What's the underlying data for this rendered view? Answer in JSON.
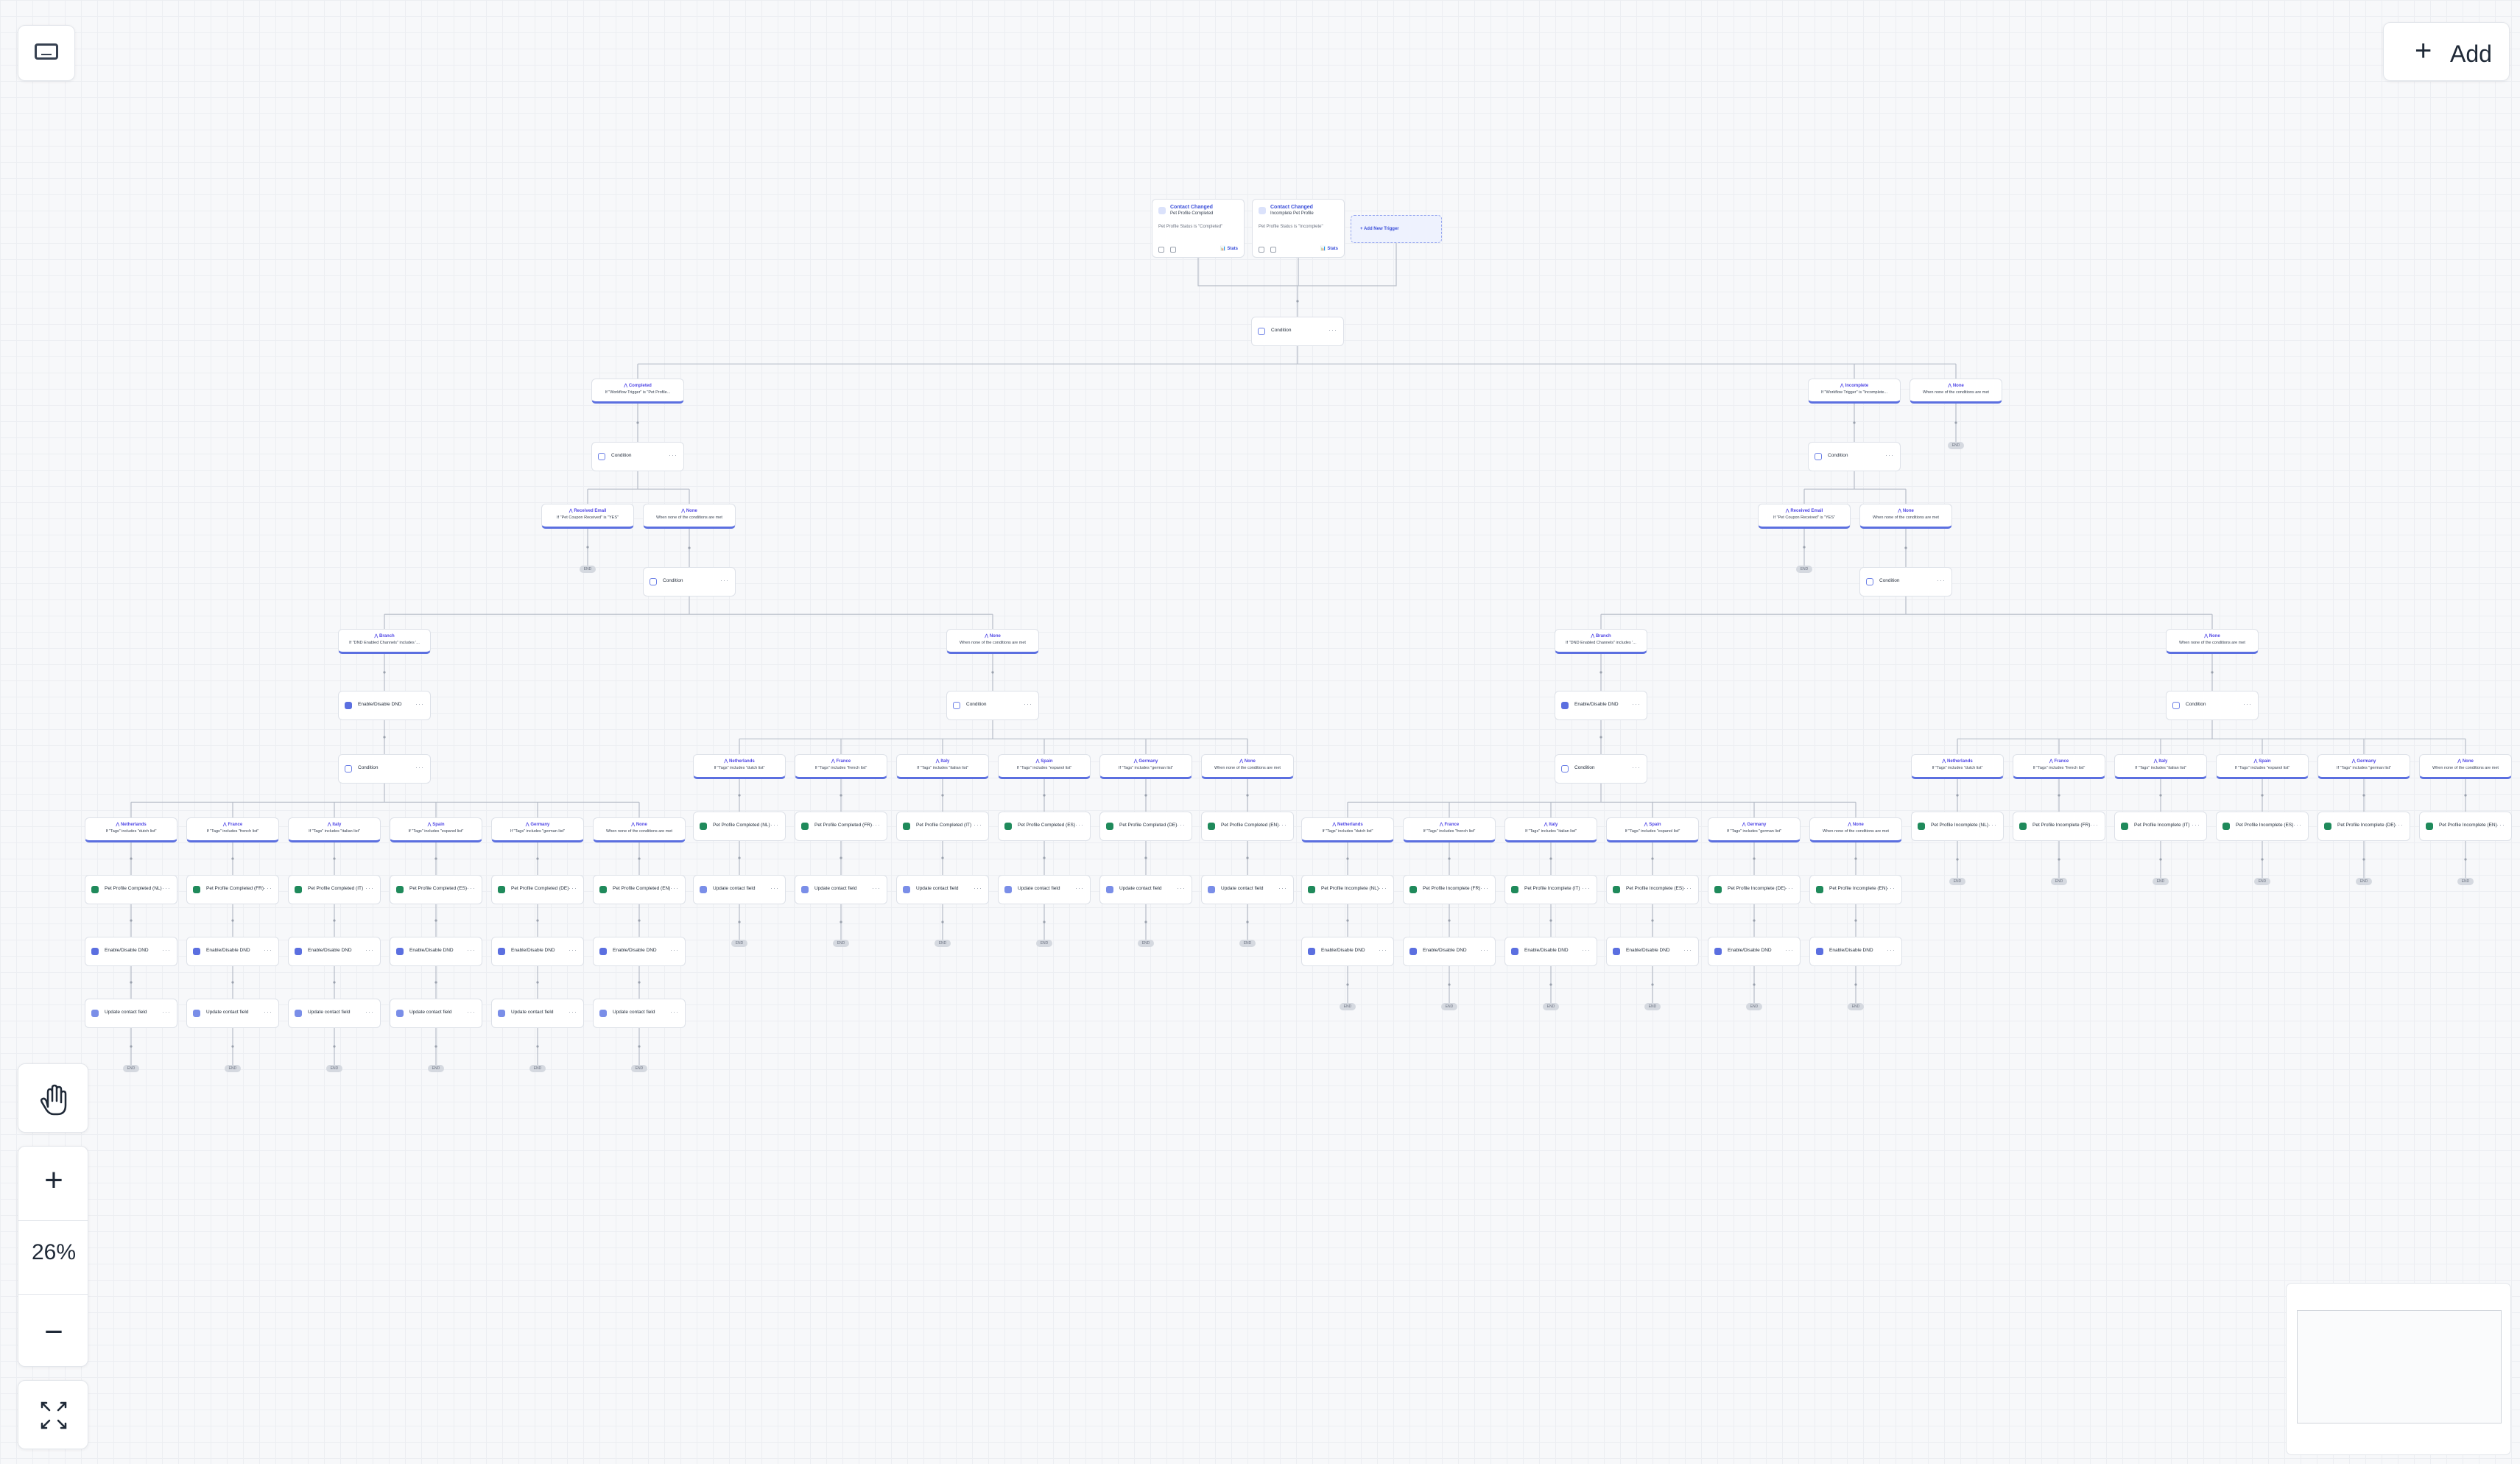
{
  "canvas": {
    "zoom_level": "26%"
  },
  "toolbar": {
    "add_label": "Add",
    "keyboard_icon": "keyboard-icon",
    "hand_icon": "hand-icon",
    "zoom_in_icon": "plus-icon",
    "zoom_out_icon": "minus-icon",
    "fit_icon": "fit-view-icon"
  },
  "colors": {
    "accent": "#4f46e5",
    "branch_underline": "#5b6fe0",
    "canvas_bg": "#f7f8fa",
    "node_border": "#dde1e8",
    "end_pill": "#d5d9e0"
  },
  "triggers": [
    {
      "title": "Contact Changed",
      "subtitle": "Pet Profile Completed",
      "desc": "Pet Profile Status is \"Completed\"",
      "stats": "Stats"
    },
    {
      "title": "Contact Changed",
      "subtitle": "Incomplete Pet Profile",
      "desc": "Pet Profile Status is \"Incomplete\"",
      "stats": "Stats"
    }
  ],
  "add_trigger": "Add New Trigger",
  "labels": {
    "condition": "Condition",
    "end": "END",
    "none": "None",
    "none_desc": "When none of the conditions are met",
    "enable_dnd": "Enable/Disable DND",
    "update_field": "Update contact field",
    "completed": "Completed",
    "completed_desc": "If \"Workflow Trigger\" is \"Pet Profile...",
    "incomplete": "Incomplete",
    "incomplete_desc": "If \"Workflow Trigger\" is \"Incomplete...",
    "received": "Received Email",
    "received_desc": "If \"Pet Coupon Received\" is \"YES\"",
    "branch": "Branch",
    "branch_desc": "If \"DND Enabled Channels\" includes '..."
  },
  "countries": [
    {
      "name": "Netherlands",
      "desc": "If \"Tags\" includes \"dutch list\"",
      "code": "NL"
    },
    {
      "name": "France",
      "desc": "If \"Tags\" includes \"french list\"",
      "code": "FR"
    },
    {
      "name": "Italy",
      "desc": "If \"Tags\" includes \"italian list\"",
      "code": "IT"
    },
    {
      "name": "Spain",
      "desc": "If \"Tags\" includes \"espanol list\"",
      "code": "ES"
    },
    {
      "name": "Germany",
      "desc": "If \"Tags\" includes \"german list\"",
      "code": "DE"
    },
    {
      "name": "None",
      "desc": "When none of the conditions are met",
      "code": "EN"
    }
  ],
  "tag_prefix": {
    "completed": "Pet Profile Completed",
    "incomplete": "Pet Profile Incomplete"
  }
}
